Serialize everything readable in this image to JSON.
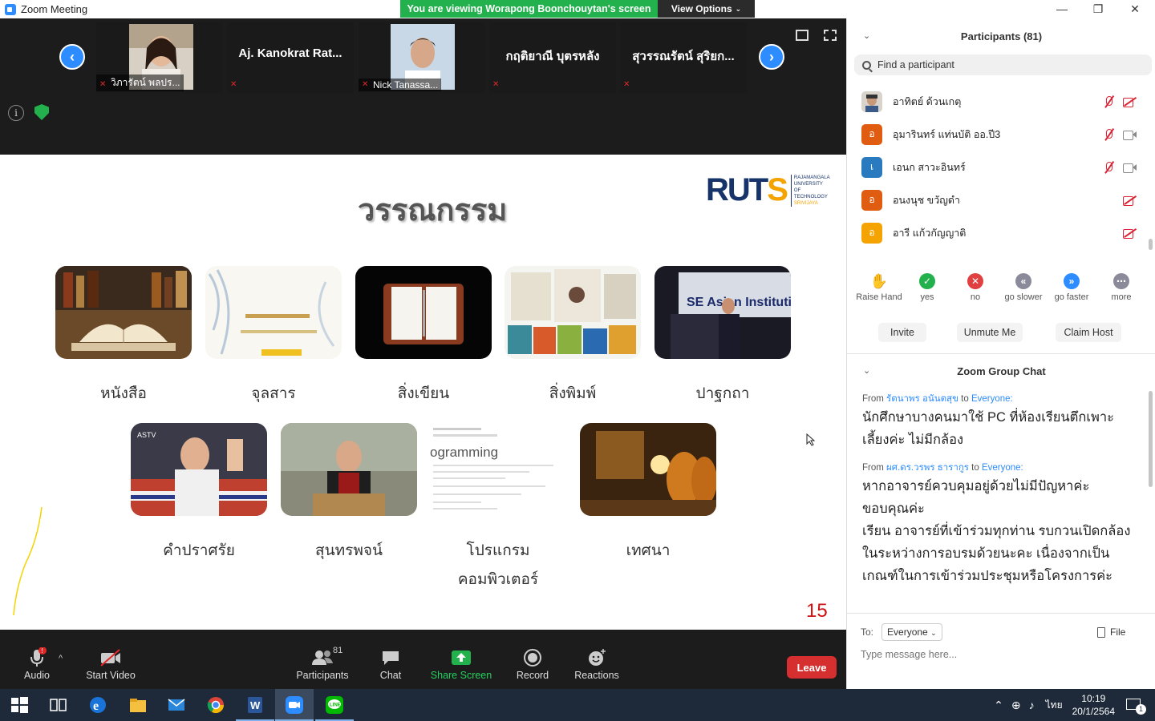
{
  "window": {
    "title": "Zoom Meeting",
    "banner": "You are viewing Worapong Boonchouytan's screen",
    "view_options": "View Options",
    "minimize": "—",
    "maximize": "❐",
    "close": "✕"
  },
  "video_strip": {
    "tiles": [
      {
        "caption": "วิภารัตน์ พลปร..."
      },
      {
        "name": "Aj. Kanokrat Rat..."
      },
      {
        "caption": "Nick Tanassa..."
      },
      {
        "name": "กฤติยาณี บุตรหลัง"
      },
      {
        "name": "สุวรรณรัตน์ สุริยก..."
      }
    ],
    "prev_arrow": "‹",
    "next_arrow": "›",
    "info": "i"
  },
  "slide": {
    "title": "วรรณกรรม",
    "logo_text": "RUT",
    "logo_s": "S",
    "logo_sub1": "RAJAMANGALA UNIVERSITY",
    "logo_sub2": "OF TECHNOLOGY",
    "logo_sub3": "SRIVIJAYA",
    "row1": [
      "หนังสือ",
      "จุลสาร",
      "สิ่งเขียน",
      "สิ่งพิมพ์",
      "ปาฐกถา"
    ],
    "row2": [
      "คำปราศรัย",
      "สุนทรพจน์",
      "โปรแกรม คอมพิวเตอร์",
      "เทศนา"
    ],
    "page_number": "15",
    "programming_snippet": "ogramming"
  },
  "toolbar": {
    "audio": "Audio",
    "audio_badge": "!",
    "start_video": "Start Video",
    "participants": "Participants",
    "participants_count": "81",
    "chat": "Chat",
    "share_screen": "Share Screen",
    "record": "Record",
    "reactions": "Reactions",
    "leave": "Leave"
  },
  "panel": {
    "participants_title": "Participants (81)",
    "search_placeholder": "Find a participant",
    "participants": [
      {
        "name": "อาทิตย์ ด้วนเกตุ",
        "initial": "",
        "color": "#8a7a6a",
        "mic": "muted",
        "cam": "off"
      },
      {
        "name": "อุมารินทร์ แท่นบัติ ออ.ปี3",
        "initial": "อ",
        "color": "#e05c10",
        "mic": "muted",
        "cam": "on"
      },
      {
        "name": "เอนก สาวะอินทร์",
        "initial": "เ",
        "color": "#2a7ac0",
        "mic": "muted",
        "cam": "on"
      },
      {
        "name": "อนงนุช ขวัญดำ",
        "initial": "อ",
        "color": "#e05c10",
        "mic": "none",
        "cam": "off"
      },
      {
        "name": "อารี แก้วกัญญาติ",
        "initial": "อ",
        "color": "#f5a300",
        "mic": "none",
        "cam": "off"
      }
    ],
    "reactions": [
      {
        "label": "Raise Hand",
        "glyph": "✋",
        "color": "#2d8cff"
      },
      {
        "label": "yes",
        "glyph": "✓",
        "color": "#23b14d"
      },
      {
        "label": "no",
        "glyph": "✕",
        "color": "#e04040"
      },
      {
        "label": "go slower",
        "glyph": "«",
        "color": "#8a8a9a"
      },
      {
        "label": "go faster",
        "glyph": "»",
        "color": "#2d8cff"
      },
      {
        "label": "more",
        "glyph": "⋯",
        "color": "#8a8a9a"
      }
    ],
    "invite": "Invite",
    "unmute_me": "Unmute Me",
    "claim_host": "Claim Host",
    "chat_title": "Zoom Group Chat",
    "messages": [
      {
        "from_prefix": "From",
        "from": "รัตนาพร อนันตสุข",
        "to_prefix": "to",
        "to": "Everyone:",
        "text": "นักศึกษาบางคนมาใช้ PC ที่ห้องเรียนตึกเพาะเลี้ยงค่ะ ไม่มีกล้อง"
      },
      {
        "from_prefix": "From",
        "from": "ผศ.ดร.วรพร ธารากูร",
        "to_prefix": "to",
        "to": "Everyone:",
        "text": "หากอาจารย์ควบคุมอยู่ด้วยไม่มีปัญหาค่ะ ขอบคุณค่ะ\nเรียน อาจารย์ที่เข้าร่วมทุกท่าน รบกวนเปิดกล้องในระหว่างการอบรมด้วยนะคะ เนื่องจากเป็นเกณฑ์ในการเข้าร่วมประชุมหรือโครงการค่ะ"
      }
    ],
    "to_label": "To:",
    "to_value": "Everyone",
    "file_label": "File",
    "message_placeholder": "Type message here..."
  },
  "taskbar": {
    "time": "10:19",
    "date": "20/1/2564",
    "lang": "ไทย",
    "notif_count": "1"
  }
}
